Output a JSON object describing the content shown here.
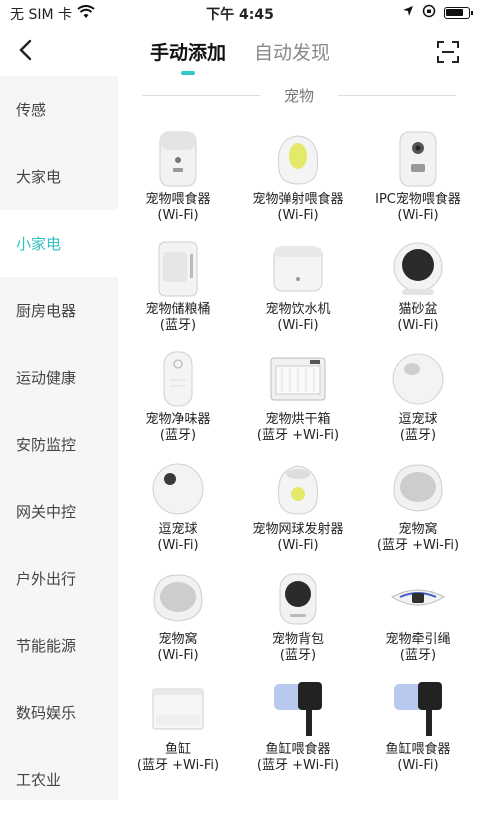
{
  "status_bar": {
    "carrier": "无 SIM 卡",
    "time": "下午 4:45"
  },
  "header": {
    "tabs": [
      {
        "label": "手动添加",
        "active": true
      },
      {
        "label": "自动发现",
        "active": false
      }
    ]
  },
  "colors": {
    "accent": "#32c7c5",
    "sidebar_bg": "#f6f6f6"
  },
  "sidebar": {
    "items": [
      {
        "label": "传感",
        "active": false
      },
      {
        "label": "大家电",
        "active": false
      },
      {
        "label": "小家电",
        "active": true
      },
      {
        "label": "厨房电器",
        "active": false
      },
      {
        "label": "运动健康",
        "active": false
      },
      {
        "label": "安防监控",
        "active": false
      },
      {
        "label": "网关中控",
        "active": false
      },
      {
        "label": "户外出行",
        "active": false
      },
      {
        "label": "节能能源",
        "active": false
      },
      {
        "label": "数码娱乐",
        "active": false
      },
      {
        "label": "工农业",
        "active": false
      }
    ]
  },
  "section": {
    "title": "宠物"
  },
  "devices": [
    {
      "name": "宠物喂食器",
      "conn": "(Wi-Fi)",
      "icon": "pet-feeder-icon"
    },
    {
      "name": "宠物弹射喂食器",
      "conn": "(Wi-Fi)",
      "icon": "pet-launch-feeder-icon"
    },
    {
      "name": "IPC宠物喂食器",
      "conn": "(Wi-Fi)",
      "icon": "ipc-pet-feeder-icon"
    },
    {
      "name": "宠物储粮桶",
      "conn": "(蓝牙)",
      "icon": "food-storage-icon"
    },
    {
      "name": "宠物饮水机",
      "conn": "(Wi-Fi)",
      "icon": "water-fountain-icon"
    },
    {
      "name": "猫砂盆",
      "conn": "(Wi-Fi)",
      "icon": "litter-box-icon"
    },
    {
      "name": "宠物净味器",
      "conn": "(蓝牙)",
      "icon": "deodorizer-icon"
    },
    {
      "name": "宠物烘干箱",
      "conn": "(蓝牙 +Wi-Fi)",
      "icon": "dryer-box-icon"
    },
    {
      "name": "逗宠球",
      "conn": "(蓝牙)",
      "icon": "toy-ball-icon"
    },
    {
      "name": "逗宠球",
      "conn": "(Wi-Fi)",
      "icon": "toy-ball-icon"
    },
    {
      "name": "宠物网球发射器",
      "conn": "(Wi-Fi)",
      "icon": "ball-launcher-icon"
    },
    {
      "name": "宠物窝",
      "conn": "(蓝牙 +Wi-Fi)",
      "icon": "pet-bed-icon"
    },
    {
      "name": "宠物窝",
      "conn": "(Wi-Fi)",
      "icon": "pet-bed-icon"
    },
    {
      "name": "宠物背包",
      "conn": "(蓝牙)",
      "icon": "pet-backpack-icon"
    },
    {
      "name": "宠物牵引绳",
      "conn": "(蓝牙)",
      "icon": "pet-leash-icon"
    },
    {
      "name": "鱼缸",
      "conn": "(蓝牙 +Wi-Fi)",
      "icon": "fish-tank-icon"
    },
    {
      "name": "鱼缸喂食器",
      "conn": "(蓝牙 +Wi-Fi)",
      "icon": "fish-feeder-icon"
    },
    {
      "name": "鱼缸喂食器",
      "conn": "(Wi-Fi)",
      "icon": "fish-feeder-icon"
    }
  ]
}
